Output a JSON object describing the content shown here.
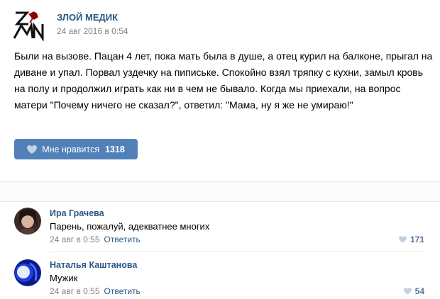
{
  "post": {
    "group_name": "ЗЛОЙ МЕДИК",
    "date": "24 авг 2016 в 0:54",
    "text": "Были на вызове. Пацан 4 лет, пока мать была в душе, а отец курил на балконе, прыгал на диване и упал. Порвал уздечку на пипиське. Спокойно взял тряпку с кухни, замыл кровь на полу и продолжил играть как ни в чем не бывало. Когда мы приехали, на вопрос матери \"Почему ничего не сказал?\", ответил: \"Мама, ну я же не умираю!\"",
    "like_label": "Мне нравится",
    "like_count": "1318"
  },
  "comments": [
    {
      "author": "Ира Грачева",
      "text": "Парень, пожалуй, адекватнее многих",
      "date": "24 авг в 0:55",
      "reply_label": "Ответить",
      "likes": "171"
    },
    {
      "author": "Наталья Каштанова",
      "text": "Мужик",
      "date": "24 авг в 0:55",
      "reply_label": "Ответить",
      "likes": "54"
    }
  ],
  "colors": {
    "link": "#2a5885",
    "button": "#5181b8",
    "meta": "#828282"
  }
}
